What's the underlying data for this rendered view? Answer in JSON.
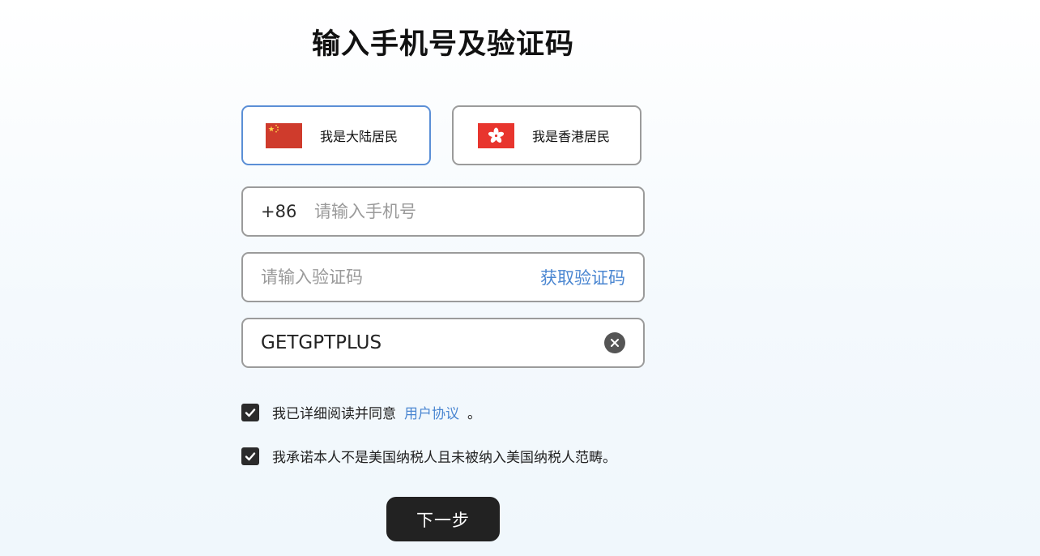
{
  "page": {
    "title": "输入手机号及验证码"
  },
  "residence": {
    "options": [
      {
        "label": "我是大陆居民",
        "flag_icon": "china-flag-icon",
        "selected": true
      },
      {
        "label": "我是香港居民",
        "flag_icon": "hong-kong-flag-icon",
        "selected": false
      }
    ]
  },
  "phone": {
    "country_code": "+86",
    "placeholder": "请输入手机号",
    "value": ""
  },
  "verification": {
    "placeholder": "请输入验证码",
    "value": "",
    "get_code_label": "获取验证码"
  },
  "invite": {
    "value": "GETGPTPLUS",
    "clear_icon": "clear-icon"
  },
  "agreements": {
    "terms_prefix": "我已详细阅读并同意",
    "terms_link": "用户协议",
    "terms_suffix": "。",
    "terms_checked": true,
    "tax_statement": "我承诺本人不是美国纳税人且未被纳入美国纳税人范畴。",
    "tax_checked": true
  },
  "actions": {
    "next_label": "下一步"
  },
  "colors": {
    "accent": "#4a86d1",
    "selected_border": "#5b8fd6",
    "button_bg": "#222222",
    "china_red": "#d1382b",
    "hk_red": "#e8352e"
  }
}
